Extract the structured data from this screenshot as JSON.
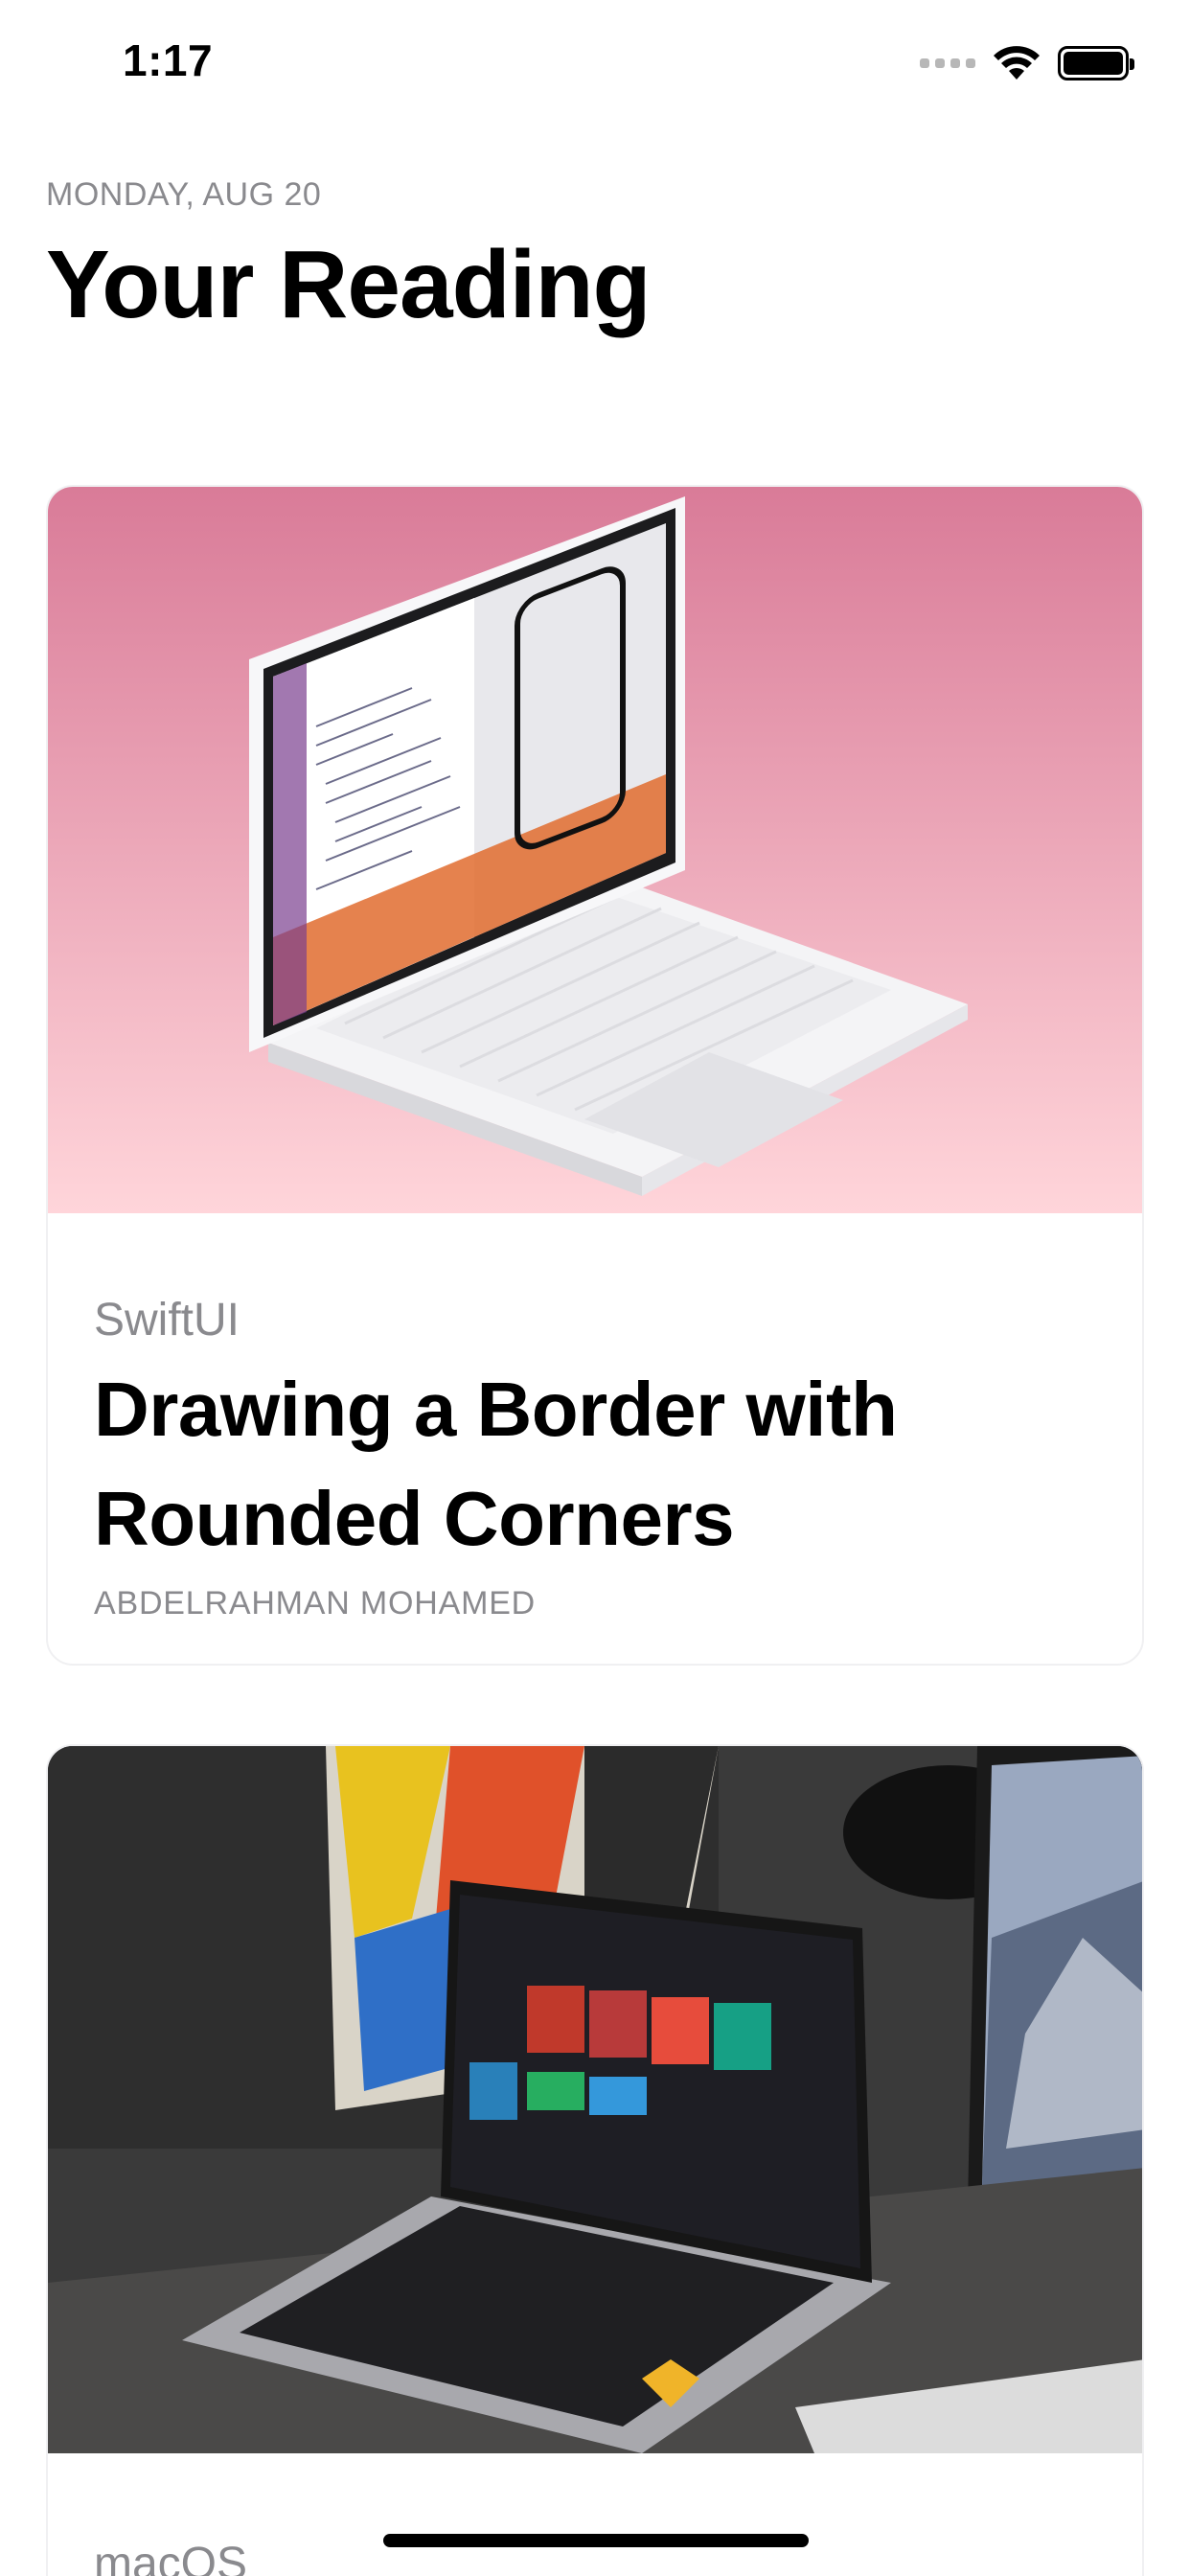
{
  "status_bar": {
    "time": "1:17"
  },
  "header": {
    "date": "MONDAY, AUG 20",
    "title": "Your Reading"
  },
  "cards": [
    {
      "category": "SwiftUI",
      "title": "Drawing a Border with Rounded Corners",
      "author": "ABDELRAHMAN MOHAMED",
      "image": "laptop-xcode-illustration"
    },
    {
      "category": "macOS",
      "image": "laptop-music-app-photo"
    }
  ],
  "colors": {
    "card1_gradient_top": "#d97b98",
    "card1_gradient_bottom": "#ffd5da",
    "secondary_text": "#8a8a8e"
  }
}
